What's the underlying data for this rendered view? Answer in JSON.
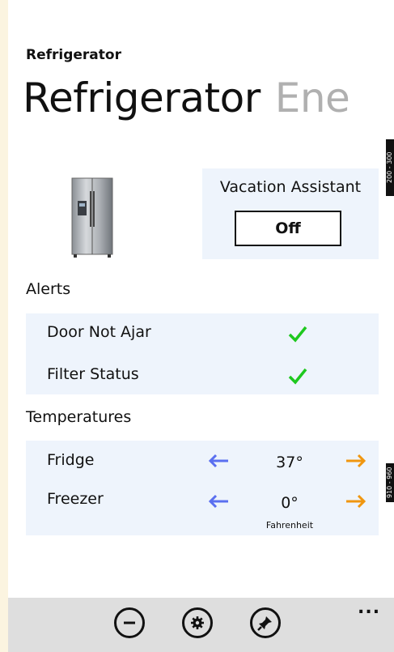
{
  "app": {
    "title": "Refrigerator"
  },
  "pivot": {
    "active": "Refrigerator",
    "next": "Ene"
  },
  "vacation": {
    "label": "Vacation Assistant",
    "button": "Off"
  },
  "alerts": {
    "heading": "Alerts",
    "items": [
      {
        "label": "Door Not Ajar",
        "status_icon": "check-icon"
      },
      {
        "label": "Filter Status",
        "status_icon": "check-icon"
      }
    ]
  },
  "temperatures": {
    "heading": "Temperatures",
    "items": [
      {
        "label": "Fridge",
        "value": "37°"
      },
      {
        "label": "Freezer",
        "value": "0°"
      }
    ],
    "unit": "Fahrenheit"
  },
  "side_tags": {
    "top": "200 - 300",
    "bottom": "910 - 960"
  },
  "appbar": {
    "buttons": [
      "minus-icon",
      "gear-icon",
      "pin-icon"
    ],
    "more": "..."
  },
  "colors": {
    "accent_blue": "#5a6ff0",
    "accent_orange": "#f0960f",
    "check_green": "#1ec81e",
    "panel_bg": "#eef4fc"
  }
}
